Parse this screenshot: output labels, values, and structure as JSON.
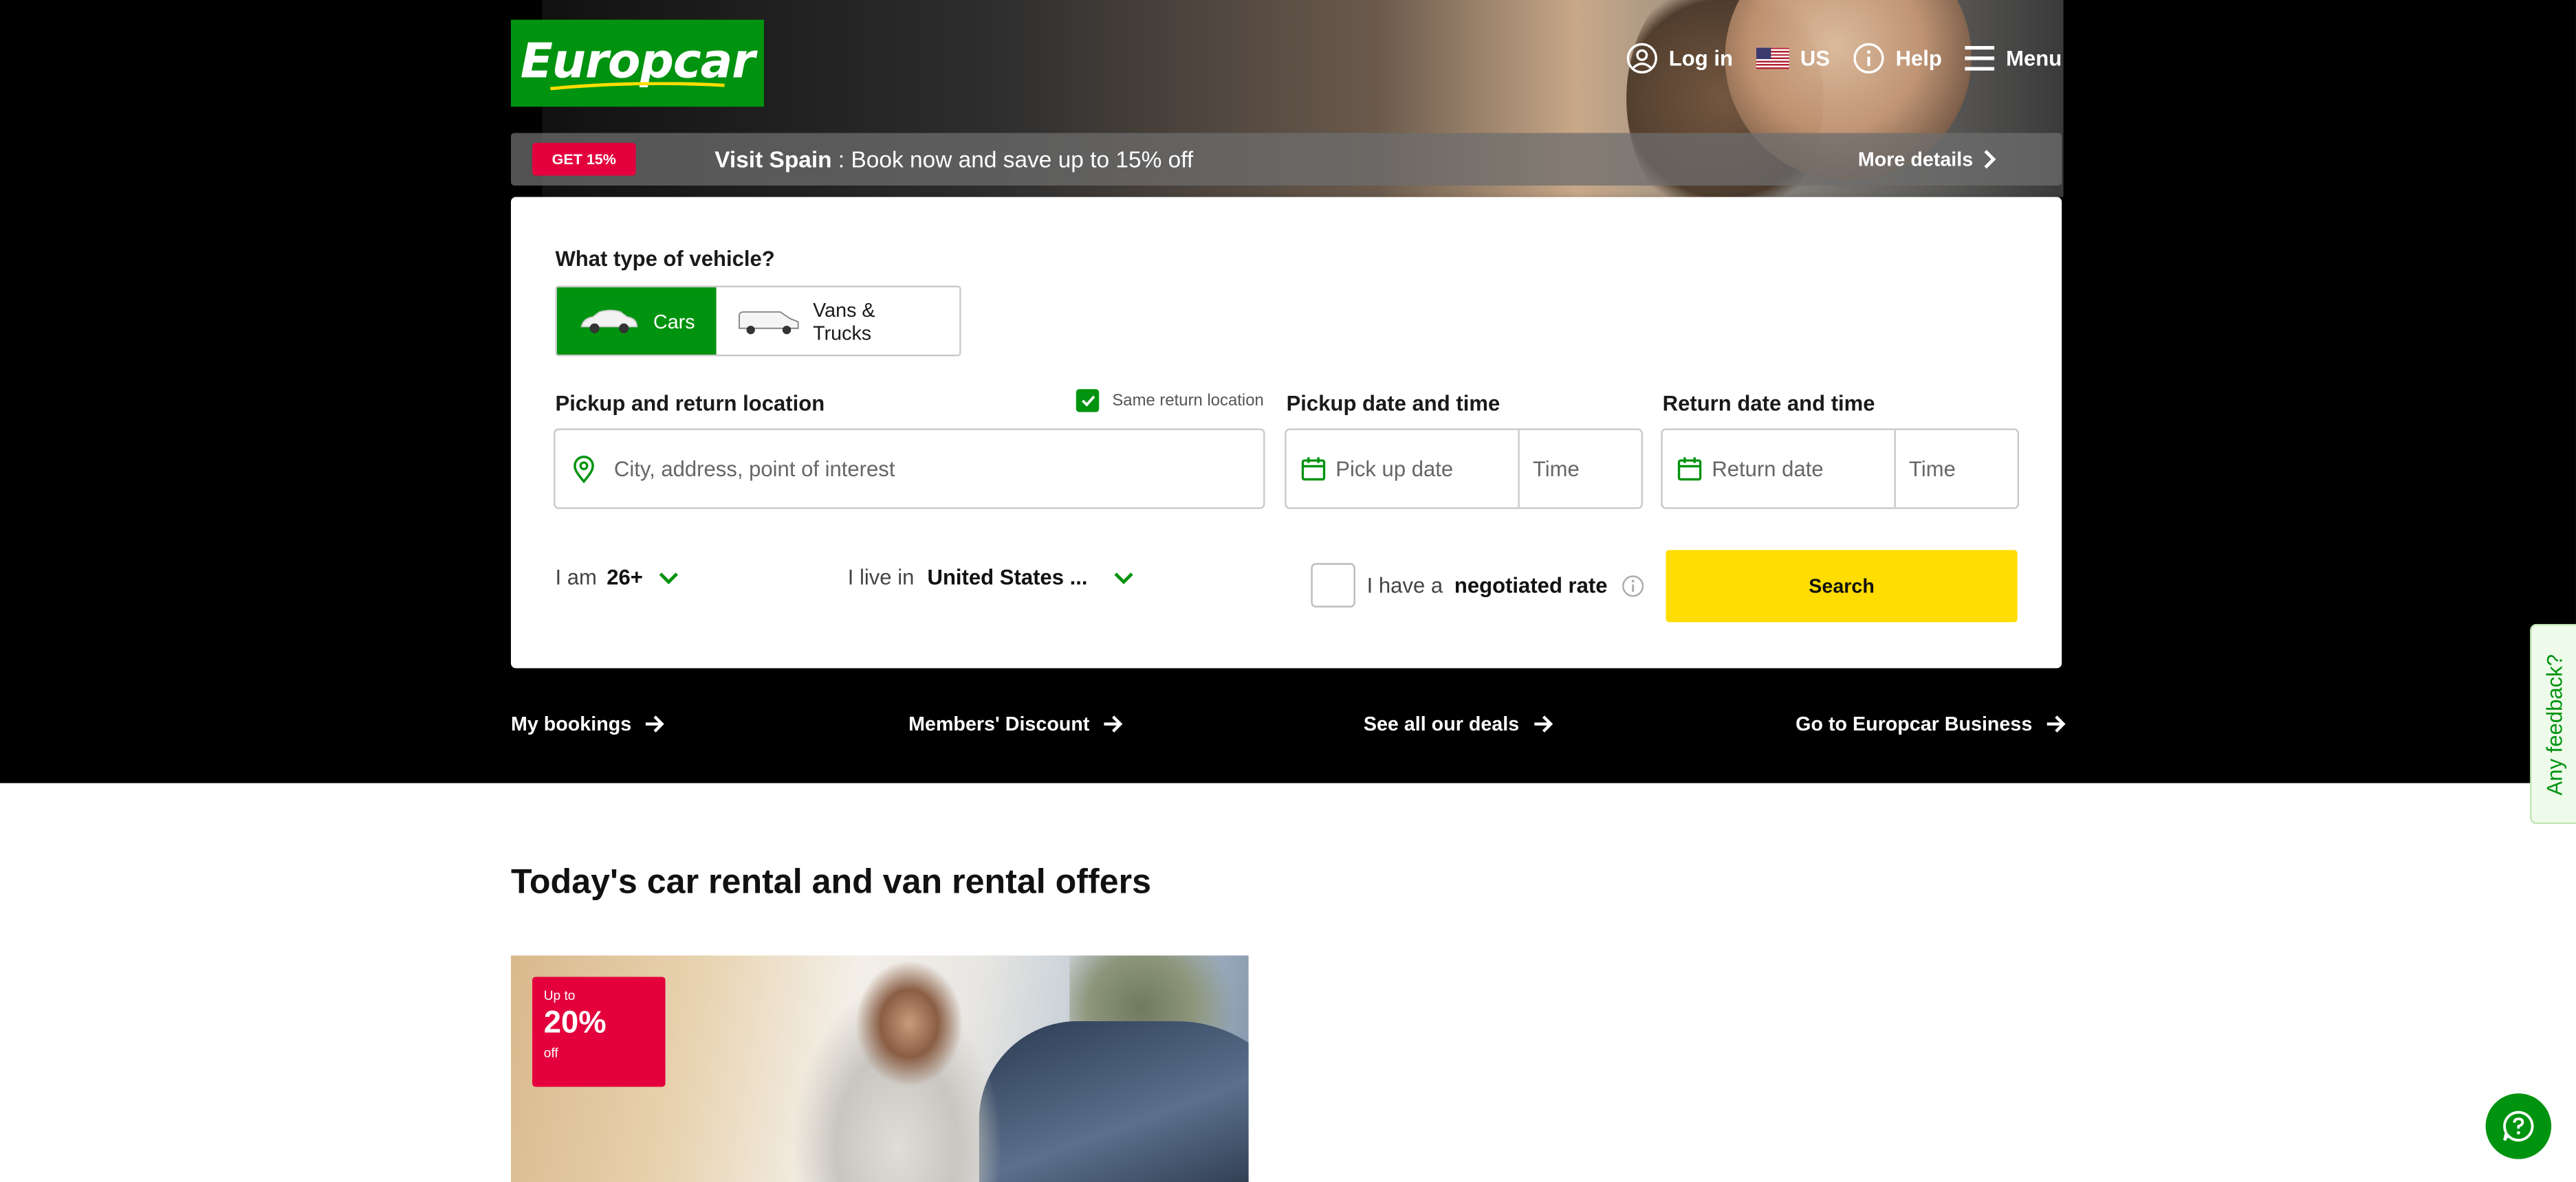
{
  "header": {
    "logo_text": "Europcar",
    "login_label": "Log in",
    "country_label": "US",
    "help_label": "Help",
    "menu_label": "Menu"
  },
  "promo": {
    "badge": "GET 15%",
    "title": "Visit Spain",
    "text": " : Book now and save up to 15% off",
    "more_label": "More details"
  },
  "booking": {
    "vehicle_question": "What type of vehicle?",
    "vehicle_options": [
      "Cars",
      "Vans & Trucks"
    ],
    "selected_vehicle": "Cars",
    "location_label": "Pickup and return location",
    "same_return_label": "Same return location",
    "same_return_checked": true,
    "location_placeholder": "City, address, point of interest",
    "pickup_label": "Pickup date and time",
    "pickup_date_placeholder": "Pick up date",
    "pickup_time_placeholder": "Time",
    "return_label": "Return date and time",
    "return_date_placeholder": "Return date",
    "return_time_placeholder": "Time",
    "age_prefix": "I am",
    "age_value": "26+",
    "residence_prefix": "I live in",
    "residence_value": "United States ...",
    "negotiated_prefix": "I have a",
    "negotiated_bold": "negotiated rate",
    "negotiated_checked": false,
    "search_label": "Search"
  },
  "quick_links": [
    "My bookings",
    "Members' Discount",
    "See all our deals",
    "Go to Europcar Business"
  ],
  "offers": {
    "title": "Today's car rental and van rental offers",
    "card_badge": {
      "line1": "Up to",
      "line2": "20%",
      "line3": "off"
    }
  },
  "feedback_label": "Any feedback?",
  "colors": {
    "brand_green": "#00930f",
    "promo_red": "#e3003d",
    "search_yellow": "#ffdd00"
  }
}
